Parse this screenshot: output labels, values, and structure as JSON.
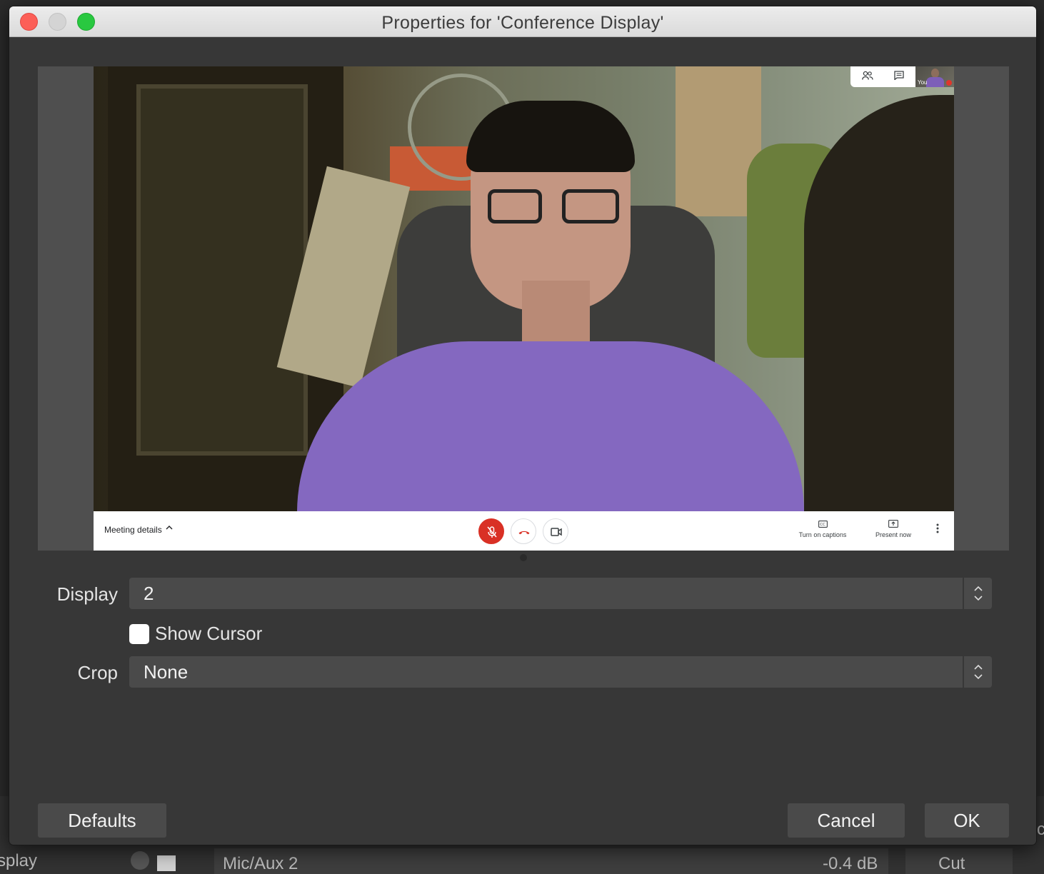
{
  "window": {
    "title": "Properties for 'Conference Display'"
  },
  "meet": {
    "self_label": "You",
    "meeting_details": "Meeting details",
    "captions_label": "Turn on captions",
    "present_label": "Present now"
  },
  "form": {
    "display_label": "Display",
    "display_value": "2",
    "show_cursor_label": "Show Cursor",
    "show_cursor_checked": false,
    "crop_label": "Crop",
    "crop_value": "None"
  },
  "buttons": {
    "defaults": "Defaults",
    "cancel": "Cancel",
    "ok": "OK"
  },
  "background_app": {
    "left_text": "splay",
    "mixer_source": "Mic/Aux 2",
    "mixer_level": "-0.4 dB",
    "transition": "Cut",
    "edge_char": "c"
  },
  "colors": {
    "dialog_bg": "#373737",
    "field_bg": "#4a4a4a",
    "mic_muted": "#d93025",
    "close_button": "#fc5f57",
    "zoom_button": "#29c840"
  },
  "icons": {
    "people": "people-icon",
    "chat": "chat-icon",
    "mic_off": "mic-off-icon",
    "hang_up": "phone-hangup-icon",
    "camera": "video-camera-icon",
    "captions": "closed-captions-icon",
    "present": "present-screen-icon",
    "more": "more-vert-icon"
  }
}
